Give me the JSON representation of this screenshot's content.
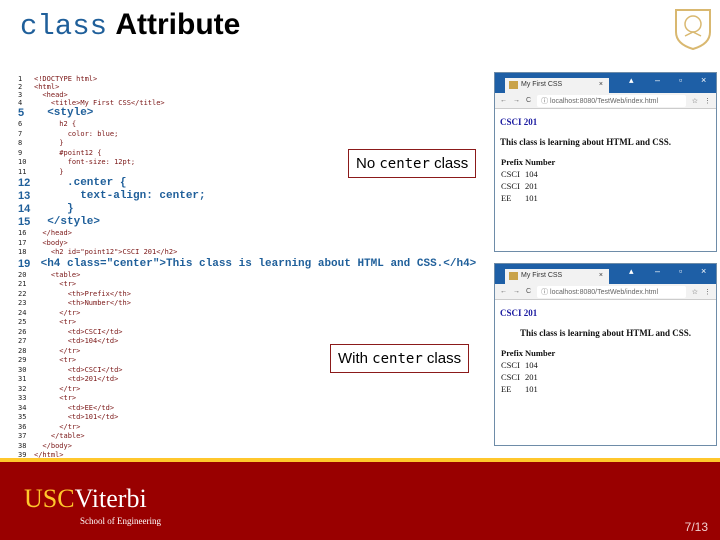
{
  "title": {
    "mono": "class",
    "bold": "Attribute"
  },
  "code": [
    {
      "n": "1",
      "t": "<!DOCTYPE html>",
      "big": false
    },
    {
      "n": "2",
      "t": "<html>",
      "big": false
    },
    {
      "n": "3",
      "t": "  <head>",
      "big": false
    },
    {
      "n": "4",
      "t": "    <title>My First CSS</title>",
      "big": false
    },
    {
      "n": "5",
      "t": "  <style>",
      "big": true
    },
    {
      "n": "6",
      "t": "      h2 {",
      "big": false
    },
    {
      "n": "7",
      "t": "        color: blue;",
      "big": false
    },
    {
      "n": "8",
      "t": "      }",
      "big": false
    },
    {
      "n": "9",
      "t": "      #point12 {",
      "big": false
    },
    {
      "n": "10",
      "t": "        font-size: 12pt;",
      "big": false
    },
    {
      "n": "11",
      "t": "      }",
      "big": false
    },
    {
      "n": "12",
      "t": "     .center {",
      "big": true
    },
    {
      "n": "13",
      "t": "       text-align: center;",
      "big": true
    },
    {
      "n": "14",
      "t": "     }",
      "big": true
    },
    {
      "n": "15",
      "t": "  </style>",
      "big": true
    },
    {
      "n": "16",
      "t": "  </head>",
      "big": false
    },
    {
      "n": "17",
      "t": "  <body>",
      "big": false
    },
    {
      "n": "18",
      "t": "    <h2 id=\"point12\">CSCI 201</h2>",
      "big": false
    },
    {
      "n": "19",
      "t": " <h4 class=\"center\">This class is learning about HTML and CSS.</h4>",
      "big": true
    },
    {
      "n": "20",
      "t": "    <table>",
      "big": false
    },
    {
      "n": "21",
      "t": "      <tr>",
      "big": false
    },
    {
      "n": "22",
      "t": "        <th>Prefix</th>",
      "big": false
    },
    {
      "n": "23",
      "t": "        <th>Number</th>",
      "big": false
    },
    {
      "n": "24",
      "t": "      </tr>",
      "big": false
    },
    {
      "n": "25",
      "t": "      <tr>",
      "big": false
    },
    {
      "n": "26",
      "t": "        <td>CSCI</td>",
      "big": false
    },
    {
      "n": "27",
      "t": "        <td>104</td>",
      "big": false
    },
    {
      "n": "28",
      "t": "      </tr>",
      "big": false
    },
    {
      "n": "29",
      "t": "      <tr>",
      "big": false
    },
    {
      "n": "30",
      "t": "        <td>CSCI</td>",
      "big": false
    },
    {
      "n": "31",
      "t": "        <td>201</td>",
      "big": false
    },
    {
      "n": "32",
      "t": "      </tr>",
      "big": false
    },
    {
      "n": "33",
      "t": "      <tr>",
      "big": false
    },
    {
      "n": "34",
      "t": "        <td>EE</td>",
      "big": false
    },
    {
      "n": "35",
      "t": "        <td>101</td>",
      "big": false
    },
    {
      "n": "36",
      "t": "      </tr>",
      "big": false
    },
    {
      "n": "37",
      "t": "    </table>",
      "big": false
    },
    {
      "n": "38",
      "t": "  </body>",
      "big": false
    },
    {
      "n": "39",
      "t": "</html>",
      "big": false
    }
  ],
  "labels": {
    "no_center": {
      "pre": "No ",
      "mono": "center",
      "post": " class"
    },
    "with_center": {
      "pre": "With ",
      "mono": "center",
      "post": " class"
    }
  },
  "browser": {
    "tab_title": "My First CSS",
    "url": "localhost:8080/TestWeb/index.html",
    "h2": "CSCI 201",
    "h4": "This class is learning about HTML and CSS.",
    "headers": [
      "Prefix",
      "Number"
    ],
    "rows": [
      [
        "CSCI",
        "104"
      ],
      [
        "CSCI",
        "201"
      ],
      [
        "EE",
        "101"
      ]
    ]
  },
  "footer": {
    "usc": "USC",
    "viterbi": "Viterbi",
    "school": "School of Engineering",
    "page": "7/13"
  },
  "colors": {
    "accent_blue": "#1f5f9a",
    "usc_cardinal": "#990000",
    "usc_gold": "#ffc72c"
  }
}
